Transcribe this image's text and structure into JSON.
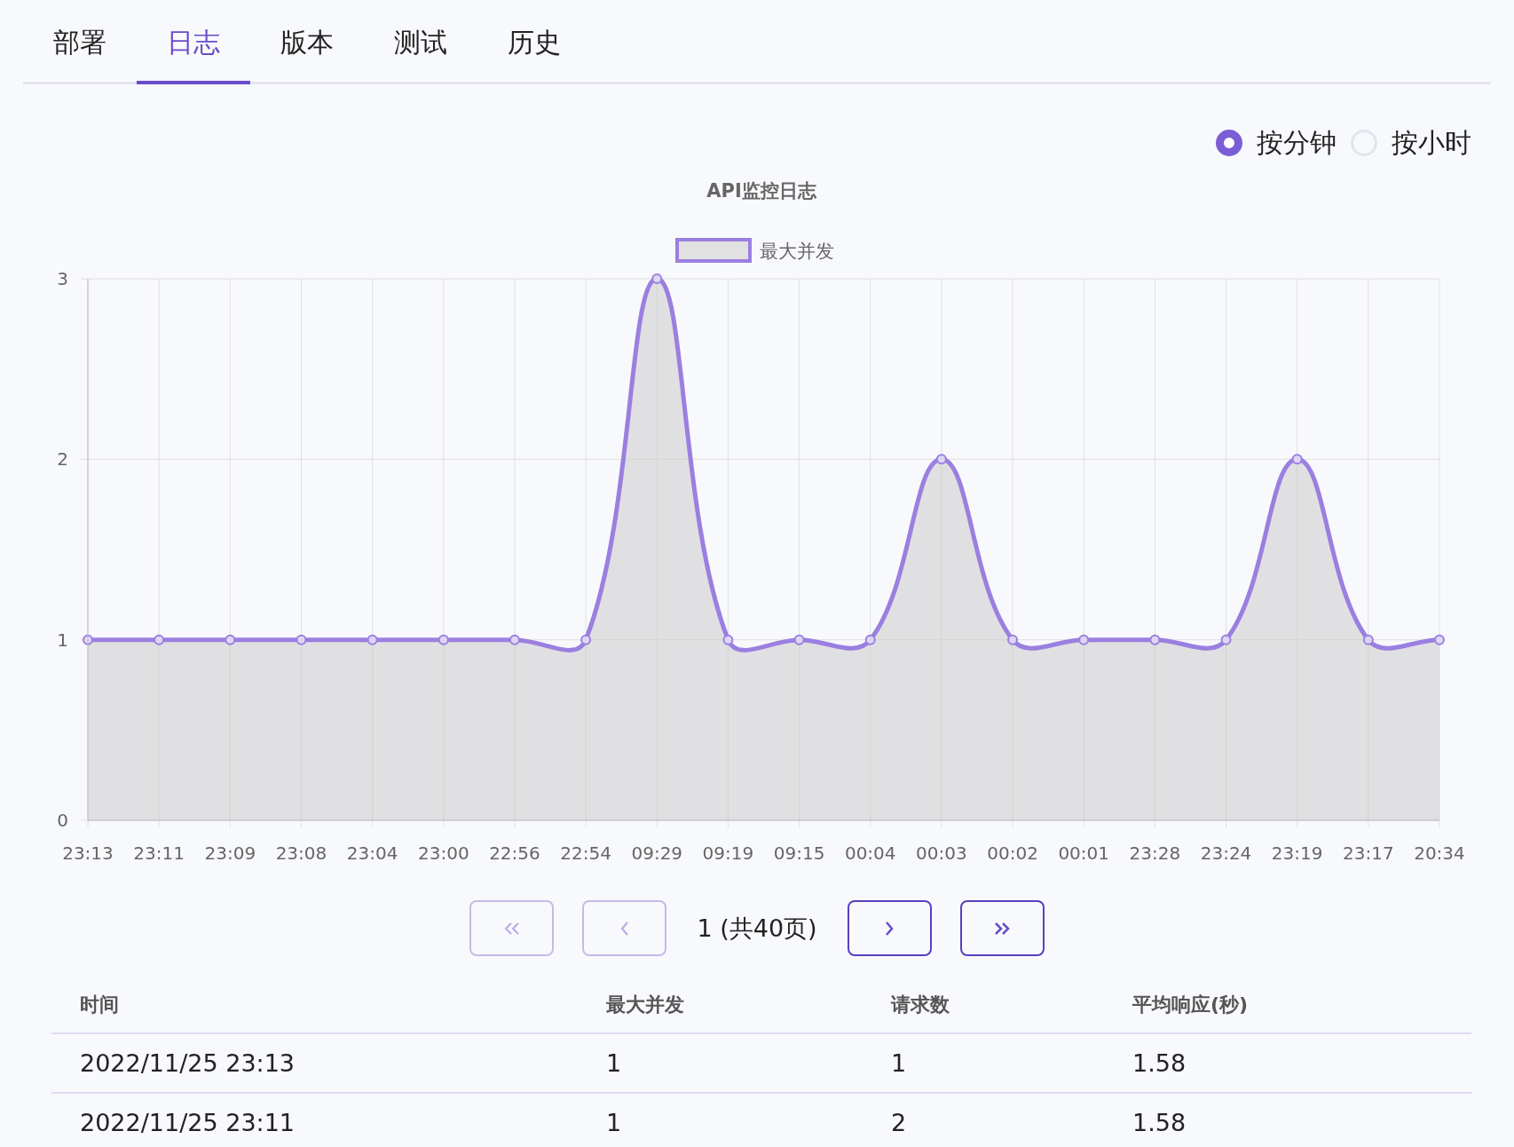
{
  "tabs": [
    {
      "label": "部署",
      "selected": false
    },
    {
      "label": "日志",
      "selected": true
    },
    {
      "label": "版本",
      "selected": false
    },
    {
      "label": "测试",
      "selected": false
    },
    {
      "label": "历史",
      "selected": false
    }
  ],
  "granularity": [
    {
      "label": "按分钟",
      "selected": true
    },
    {
      "label": "按小时",
      "selected": false
    }
  ],
  "chart_data": {
    "type": "area",
    "title": "API监控日志",
    "categories": [
      "23:13",
      "23:11",
      "23:09",
      "23:08",
      "23:04",
      "23:00",
      "22:56",
      "22:54",
      "09:29",
      "09:19",
      "09:15",
      "00:04",
      "00:03",
      "00:02",
      "00:01",
      "23:28",
      "23:24",
      "23:19",
      "23:17",
      "20:34"
    ],
    "series": [
      {
        "name": "最大并发",
        "color": "#9b7fe0",
        "values": [
          1,
          1,
          1,
          1,
          1,
          1,
          1,
          1,
          3,
          1,
          1,
          1,
          2,
          1,
          1,
          1,
          1,
          2,
          1,
          1
        ]
      }
    ],
    "grid": true,
    "ylim": [
      0,
      3
    ],
    "yticks": [
      0,
      1,
      2,
      3
    ]
  },
  "pager": {
    "first_disabled": true,
    "prev_disabled": true,
    "text": "1 (共40页)",
    "next_disabled": false,
    "last_disabled": false
  },
  "table": {
    "columns": [
      "时间",
      "最大并发",
      "请求数",
      "平均响应(秒)"
    ],
    "rows": [
      [
        "2022/11/25 23:13",
        "1",
        "1",
        "1.58"
      ],
      [
        "2022/11/25 23:11",
        "1",
        "2",
        "1.58"
      ]
    ]
  }
}
